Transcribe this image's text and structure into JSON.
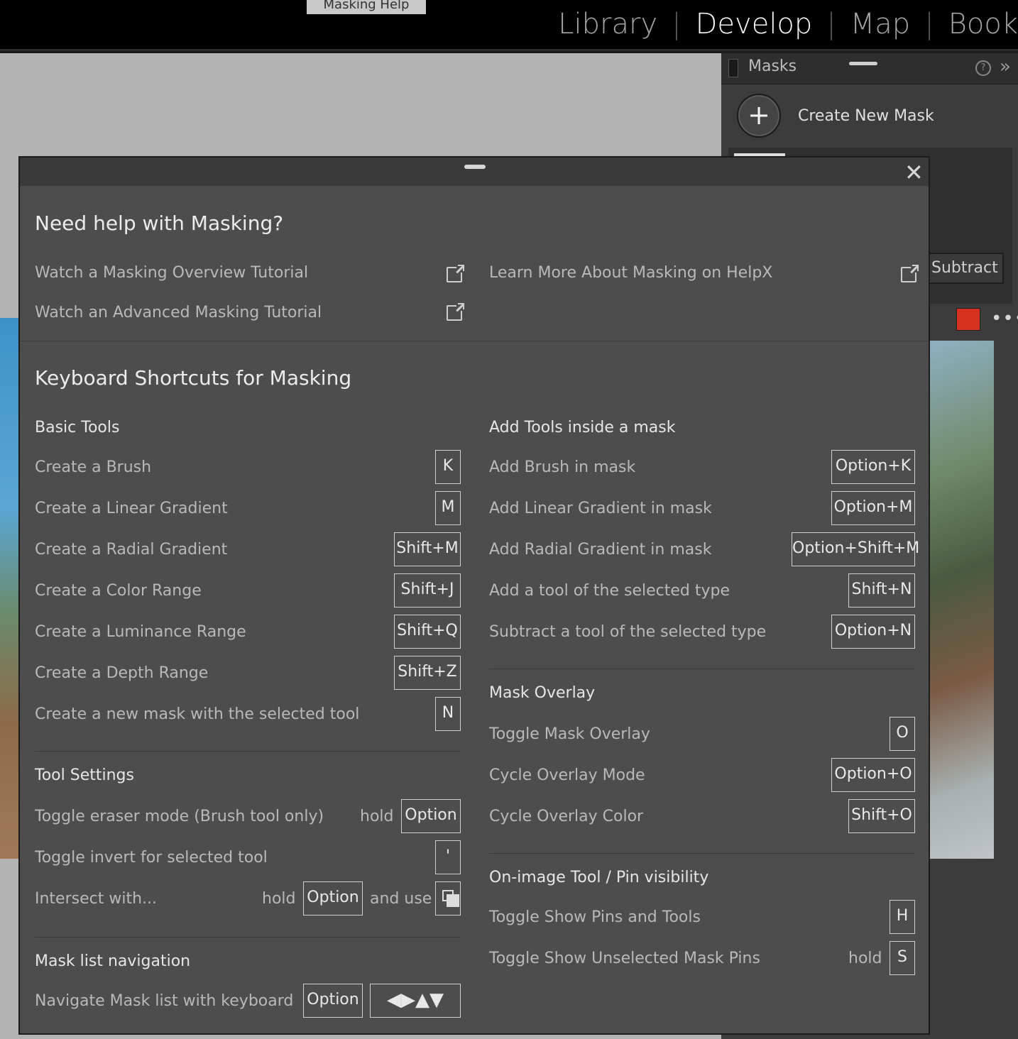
{
  "topbar": {
    "tooltip": "Masking Help",
    "modules": [
      {
        "label": "Library",
        "active": false
      },
      {
        "label": "Develop",
        "active": true
      },
      {
        "label": "Map",
        "active": false
      },
      {
        "label": "Book",
        "active": false
      }
    ]
  },
  "masks_panel": {
    "title": "Masks",
    "help_icon": "?",
    "collapse_icon": "»",
    "create_label": "Create New Mask",
    "subtract_label": "Subtract",
    "overlay_color": "#d7311f",
    "more_icon": "•••"
  },
  "modal": {
    "close_icon": "✕",
    "help_title": "Need help with Masking?",
    "links": {
      "overview": "Watch a Masking Overview Tutorial",
      "advanced": "Watch an Advanced Masking Tutorial",
      "helpx": "Learn More About Masking on HelpX"
    },
    "shortcuts_title": "Keyboard Shortcuts for Masking",
    "basic_tools": {
      "title": "Basic Tools",
      "items": [
        {
          "label": "Create a Brush",
          "key": "K"
        },
        {
          "label": "Create a Linear Gradient",
          "key": "M"
        },
        {
          "label": "Create a Radial Gradient",
          "key": "Shift+M"
        },
        {
          "label": "Create a Color Range",
          "key": "Shift+J"
        },
        {
          "label": "Create a Luminance Range",
          "key": "Shift+Q"
        },
        {
          "label": "Create a Depth Range",
          "key": "Shift+Z"
        },
        {
          "label": "Create a new mask with the selected tool",
          "key": "N"
        }
      ]
    },
    "tool_settings": {
      "title": "Tool Settings",
      "eraser_label": "Toggle eraser mode (Brush tool only)",
      "eraser_hold": "hold",
      "eraser_key": "Option",
      "invert_label": "Toggle invert for selected tool",
      "invert_key": "'",
      "intersect_label": "Intersect with...",
      "intersect_hold": "hold",
      "intersect_key": "Option",
      "intersect_and_use": "and use"
    },
    "mask_list_nav": {
      "title": "Mask list navigation",
      "label": "Navigate Mask list with keyboard",
      "key": "Option",
      "arrows": "◀▶▲▼"
    },
    "add_tools": {
      "title": "Add Tools inside a mask",
      "items": [
        {
          "label": "Add Brush in mask",
          "key": "Option+K"
        },
        {
          "label": "Add Linear Gradient in mask",
          "key": "Option+M"
        },
        {
          "label": "Add Radial Gradient in mask",
          "key": "Option+Shift+M"
        },
        {
          "label": "Add a tool of the selected type",
          "key": "Shift+N"
        },
        {
          "label": "Subtract a tool of the selected type",
          "key": "Option+N"
        }
      ]
    },
    "mask_overlay": {
      "title": "Mask Overlay",
      "items": [
        {
          "label": "Toggle Mask Overlay",
          "key": "O"
        },
        {
          "label": "Cycle Overlay Mode",
          "key": "Option+O"
        },
        {
          "label": "Cycle Overlay Color",
          "key": "Shift+O"
        }
      ]
    },
    "pin_visibility": {
      "title": "On-image Tool / Pin visibility",
      "pins_label": "Toggle Show Pins and Tools",
      "pins_key": "H",
      "unselected_label": "Toggle Show Unselected Mask Pins",
      "unselected_hold": "hold",
      "unselected_key": "S"
    }
  }
}
